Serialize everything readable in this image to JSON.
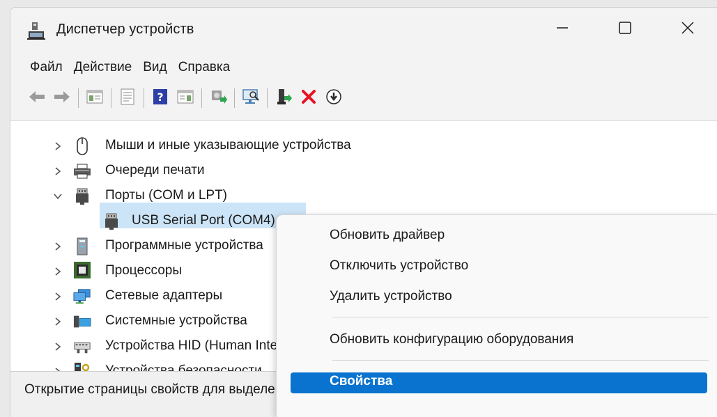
{
  "window": {
    "title": "Диспетчер устройств",
    "controls": {
      "minimize": "minimize",
      "maximize": "maximize",
      "close": "close"
    }
  },
  "menu": [
    "Файл",
    "Действие",
    "Вид",
    "Справка"
  ],
  "toolbar": [
    "back-icon",
    "forward-icon",
    "show-hide-console-tree-icon",
    "properties-icon",
    "help-icon",
    "action-pane-icon",
    "update-driver-icon",
    "scan-hardware-icon",
    "enable-device-icon",
    "uninstall-device-icon",
    "disable-device-icon"
  ],
  "tree": {
    "items": [
      {
        "label": "Мыши и иные указывающие устройства",
        "expanded": false,
        "icon": "mouse-icon"
      },
      {
        "label": "Очереди печати",
        "expanded": false,
        "icon": "printer-icon"
      },
      {
        "label": "Порты (COM и LPT)",
        "expanded": true,
        "icon": "port-icon"
      },
      {
        "label": "USB Serial Port (COM4)",
        "child": true,
        "selected": true,
        "icon": "port-icon"
      },
      {
        "label": "Программные устройства",
        "expanded": false,
        "icon": "software-device-icon"
      },
      {
        "label": "Процессоры",
        "expanded": false,
        "icon": "processor-icon"
      },
      {
        "label": "Сетевые адаптеры",
        "expanded": false,
        "icon": "network-adapter-icon"
      },
      {
        "label": "Системные устройства",
        "expanded": false,
        "icon": "system-device-icon"
      },
      {
        "label": "Устройства HID (Human Interface Devices)",
        "expanded": false,
        "icon": "hid-icon"
      },
      {
        "label": "Устройства безопасности",
        "expanded": false,
        "icon": "security-device-icon"
      }
    ]
  },
  "status": "Открытие страницы свойств для выделенного объекта.",
  "context_menu": {
    "items": [
      "Обновить драйвер",
      "Отключить устройство",
      "Удалить устройство",
      "Обновить конфигурацию оборудования",
      "Свойства"
    ],
    "highlighted": "Свойства"
  },
  "colors": {
    "selection": "#cce4f7",
    "menu_highlight": "#0a73d0",
    "delete_red": "#e81123",
    "enable_green": "#2ea44f"
  }
}
